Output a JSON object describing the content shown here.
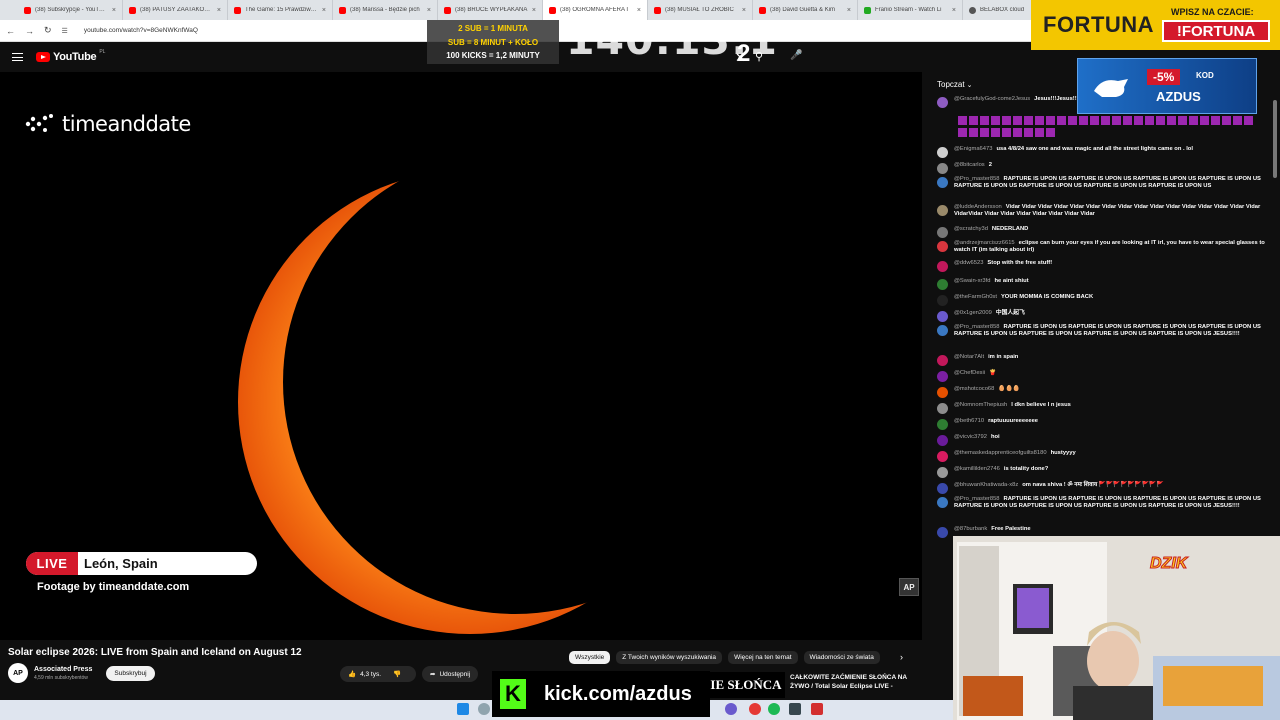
{
  "browser": {
    "tabs": [
      {
        "label": "(38) Subskrypcje - YouTube",
        "color": "#ff0000"
      },
      {
        "label": "(38) PATUSY ZAATAKOWAŁY",
        "color": "#ff0000"
      },
      {
        "label": "The Game: 15 Prawdziwych",
        "color": "#ff0000"
      },
      {
        "label": "(38) Marissa - Będzie pich",
        "color": "#ff0000"
      },
      {
        "label": "(38) BRUCE WYPŁAKANA",
        "color": "#ff0000"
      },
      {
        "label": "(38) OGROMNA AFERA I",
        "color": "#ff0000"
      },
      {
        "label": "(38) MUSIAŁ TO ZROBIĆ",
        "color": "#ff0000"
      },
      {
        "label": "(38) David Guetta & Kim",
        "color": "#ff0000"
      },
      {
        "label": "Franio Stream - Watch Li",
        "color": "#22aa22"
      },
      {
        "label": "BELABOX cloud",
        "color": "#555555"
      }
    ],
    "url": "youtube.com/watch?v=8GeNWKnfWaQ"
  },
  "youtube": {
    "logo_text": "YouTube",
    "region": "PL"
  },
  "video": {
    "brand": "timeanddate",
    "live_label": "LIVE",
    "location": "León, Spain",
    "footage": "Footage by timeanddate.com",
    "corner_badge": "AP",
    "title": "Solar eclipse 2026: LIVE from Spain and Iceland on August 12",
    "channel_name": "Associated Press",
    "channel_subs": "4,59 mln subskrybentów",
    "channel_avatar": "AP",
    "subscribe_label": "Subskrybuj",
    "like_count": "4,3 tys.",
    "share_label": "Udostępnij"
  },
  "chips": [
    "Wszystkie",
    "Z Twoich wyników wyszukiwania",
    "Więcej na ten temat",
    "Wiadomości ze świata"
  ],
  "recommendation": {
    "thumb_text": "IE SŁOŃCA",
    "title": "CAŁKOWITE ZAĆMIENIE SŁOŃCA NA ŻYWO / Total Solar Eclipse LIVE -"
  },
  "chat": {
    "header": "Topczat",
    "messages": [
      {
        "user": "@GracefulyGod-come2Jesus",
        "text": "Jesus!!!Jesus!!!Jesus!!!Jesus!!!",
        "color": "#8e5cc2"
      },
      {
        "user": "@Enigma6473",
        "text": "usa 4/8/24 saw one and was magic and all the street lights came on . lol",
        "color": "#cfcfcf"
      },
      {
        "user": "@8bitcarlos",
        "text": "2",
        "color": "#888888"
      },
      {
        "user": "@Pro_master858",
        "text": "RAPTURE IS UPON US RAPTURE IS UPON US RAPTURE IS UPON US RAPTURE IS UPON US RAPTURE IS UPON US RAPTURE IS UPON US RAPTURE IS UPON US RAPTURE IS UPON US",
        "color": "#3a78c2"
      },
      {
        "user": "@luddeAndersson",
        "text": "Vidar Vidar Vidar Vidar Vidar Vidar Vidar Vidar Vidar Vidar Vidar Vidar Vidar Vidar Vidar Vidar VidarVidar Vidar Vidar Vidar Vidar Vidar Vidar Vidar",
        "color": "#9a8a6a"
      },
      {
        "user": "@scratchy3d",
        "text": "NEDERLAND",
        "color": "#777777"
      },
      {
        "user": "@andrzejmarciszz6615",
        "text": "eclipse can burn your eyes if you are looking at IT irl, you have to wear special glasses to watch IT (im talking about irl)",
        "color": "#d9363e"
      },
      {
        "user": "@ddw6523",
        "text": "Stop with the free stuff!",
        "color": "#c2185b"
      },
      {
        "user": "@Swain-xr3fd",
        "text": "he aint shiut",
        "color": "#2e7d32"
      },
      {
        "user": "@theFarmGh0st",
        "text": "YOUR MOMMA IS COMING BACK",
        "color": "#222222"
      },
      {
        "user": "@0x1gen2009",
        "text": "中国人起飞",
        "color": "#6a5acd"
      },
      {
        "user": "@Pro_master858",
        "text": "RAPTURE IS UPON US RAPTURE IS UPON US RAPTURE IS UPON US RAPTURE IS UPON US RAPTURE IS UPON US RAPTURE IS UPON US RAPTURE IS UPON US RAPTURE IS UPON US JESUS!!!!",
        "color": "#3a78c2"
      },
      {
        "user": "@Notar7Alt",
        "text": "im in spain",
        "color": "#c2185b"
      },
      {
        "user": "@ChefDesii",
        "text": "🍟",
        "color": "#7b1fa2"
      },
      {
        "user": "@mshotcoco68",
        "text": "🥚🥚🥚",
        "color": "#e65100"
      },
      {
        "user": "@NomnomThepiush",
        "text": "I dkn believe I n jesus",
        "color": "#8d8d8d"
      },
      {
        "user": "@beth6710",
        "text": "raptuuuureeeeeee",
        "color": "#2e7d32"
      },
      {
        "user": "@vicvic3792",
        "text": "hoi",
        "color": "#6a1b9a"
      },
      {
        "user": "@themaskedapprenticeofguilts8180",
        "text": "hustyyyy",
        "color": "#d81b60"
      },
      {
        "user": "@kamillilden2746",
        "text": "is totality done?",
        "color": "#999999"
      },
      {
        "user": "@bhuwanKhatiwada-x8z",
        "text": "om nava shiva ! ॐ नमः शिवाय 🚩🚩🚩🚩🚩🚩🚩🚩🚩",
        "color": "#3949ab"
      },
      {
        "user": "@Pro_master858",
        "text": "RAPTURE IS UPON US RAPTURE IS UPON US RAPTURE IS UPON US RAPTURE IS UPON US RAPTURE IS UPON US RAPTURE IS UPON US RAPTURE IS UPON US RAPTURE IS UPON US JESUS!!!!",
        "color": "#3a78c2"
      },
      {
        "user": "@87burbank",
        "text": "Free Palestine",
        "color": "#3949ab"
      }
    ]
  },
  "overlays": {
    "fortuna_logo": "FORTUNA",
    "fortuna_line1": "WPISZ NA CZACIE:",
    "fortuna_line2": "!FORTUNA",
    "dzik_discount": "-5%",
    "dzik_kod": "KOD",
    "dzik_code": "AZDUS",
    "timer": "140:13:1",
    "timer_sub": "2",
    "goal1": "2 SUB = 1 MINUTA",
    "goal2": "SUB = 8 MINUT + KOŁO",
    "goal3": "100 KICKS = 1,2 MINUTY",
    "kick_url": "kick.com/azdus",
    "kick_letter": "K",
    "cam_logo": "DZIK"
  }
}
